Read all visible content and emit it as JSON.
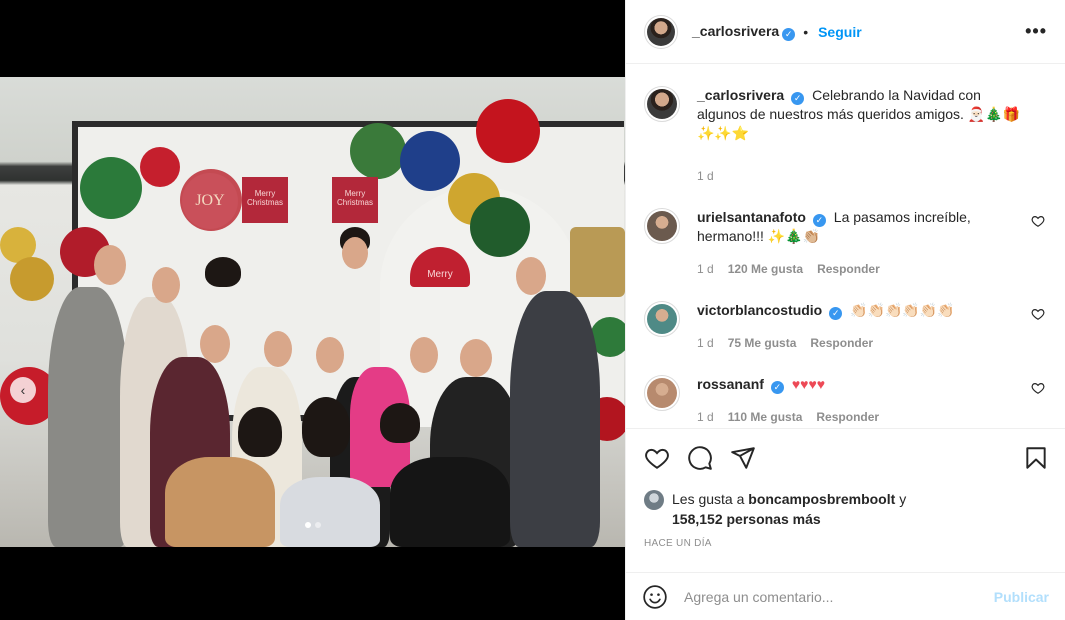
{
  "post": {
    "author": "_carlosrivera",
    "follow_label": "Seguir",
    "more_label": "•••",
    "verified_glyph": "✓",
    "caption": "Celebrando la Navidad con algunos de nuestros más queridos amigos. 🎅🏻🎄🎁✨✨⭐",
    "caption_time": "1 d"
  },
  "photo": {
    "sign_left": "Merry Christmas",
    "sign_right": "Merry Christmas",
    "joy_text": "JOY",
    "merry_text": "Merry",
    "carousel_prev": "‹",
    "slide_count": 2,
    "active_slide": 1
  },
  "comments": [
    {
      "user": "urielsantanafoto",
      "verified": true,
      "text": "La pasamos increíble, hermano!!! ✨🎄👏🏼",
      "time": "1 d",
      "likes": "120 Me gusta",
      "reply": "Responder",
      "avatar_color": "#6b5a4e"
    },
    {
      "user": "victorblancostudio",
      "verified": true,
      "text": "👏🏻👏🏻👏🏻👏🏻👏🏻👏🏻",
      "time": "1 d",
      "likes": "75 Me gusta",
      "reply": "Responder",
      "avatar_color": "#4f8a86"
    },
    {
      "user": "rossananf",
      "verified": true,
      "text": "♥♥♥♥",
      "time": "1 d",
      "likes": "110 Me gusta",
      "reply": "Responder",
      "avatar_color": "#b78a6e"
    }
  ],
  "actions": {
    "icons": [
      "heart-icon",
      "comment-icon",
      "share-icon",
      "save-icon"
    ]
  },
  "likes": {
    "prefix": "Les gusta a",
    "user": "boncamposbremboolt",
    "connector": "y",
    "others": "158,152 personas más"
  },
  "timestamp": "HACE UN DÍA",
  "add_comment": {
    "placeholder": "Agrega un comentario...",
    "publish_label": "Publicar"
  },
  "colors": {
    "accent": "#0095f6",
    "verified": "#3897f0",
    "publish_disabled": "#b2dffc",
    "muted": "#8e8e8e",
    "heart_red": "#ed4956"
  }
}
